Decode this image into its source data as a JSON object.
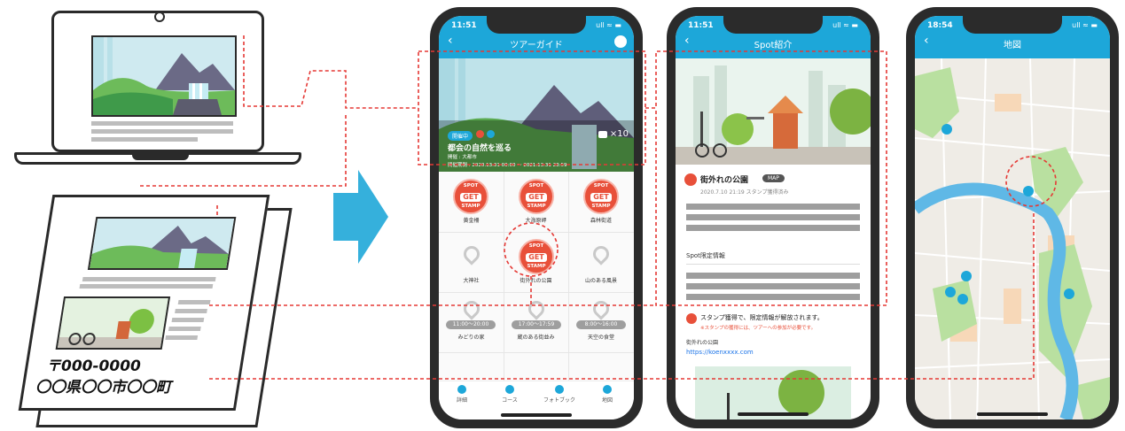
{
  "colors": {
    "brand": "#1da7d9",
    "accent": "#e8503a",
    "connector": "#e53935"
  },
  "document": {
    "postal_code": "〒000-0000",
    "address": "〇〇県〇〇市〇〇町"
  },
  "phone1": {
    "status_time": "11:51",
    "status_icons": "ull ≈ ▬",
    "title": "ツアーガイド",
    "badge": "開催中",
    "tour_title": "都会の自然を巡る",
    "organizer": "開催 : 大都市",
    "period": "開催期間 : 2020.13.31 00:00 ～ 2021.13.31 23:59",
    "stamp_count": "×10",
    "stamp_top": "SPOT",
    "stamp_mid": "GET",
    "stamp_bottom": "STAMP",
    "cells": [
      {
        "num": "1",
        "label": "黄金柵"
      },
      {
        "num": "2",
        "label": "大海原岬"
      },
      {
        "num": "3",
        "label": "森林街道"
      },
      {
        "num": "4",
        "label": "大神社"
      },
      {
        "num": "5",
        "label": "街外れの公園"
      },
      {
        "num": "6",
        "label": "山のある風景"
      },
      {
        "num": "7",
        "label": "みどりの家",
        "time": "11:00～20:00"
      },
      {
        "num": "8",
        "label": "蔵のある街並み",
        "time": "17:00～17:59"
      },
      {
        "num": "9",
        "label": "天空の食堂",
        "time": "8:00～16:00"
      }
    ],
    "tabs": [
      "詳細",
      "コース",
      "フォトブック",
      "地図"
    ]
  },
  "phone2": {
    "status_time": "11:51",
    "title": "Spot紹介",
    "spot_name": "街外れの公園",
    "map_badge": "MAP",
    "stamp_date": "2020.7.10 21:19 スタンプ獲得済み",
    "section_label": "Spot限定情報",
    "notice": "スタンプ獲得で、限定情報が解放されます。",
    "notice_sub": "※スタンプの獲得には、ツアーへの参加が必要です。",
    "link_label": "街外れの公園",
    "link_url": "https://koenxxxx.com"
  },
  "phone3": {
    "status_time": "18:54",
    "title": "地図"
  }
}
